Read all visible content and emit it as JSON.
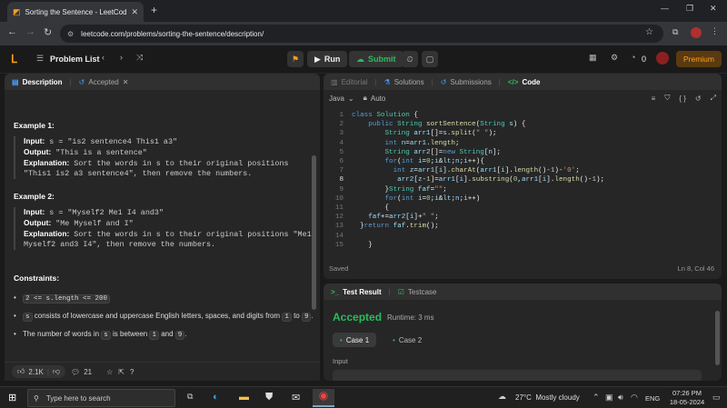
{
  "browser": {
    "tab_title": "Sorting the Sentence - LeetCod",
    "url": "leetcode.com/problems/sorting-the-sentence/description/"
  },
  "header": {
    "problem_list": "Problem List",
    "run": "Run",
    "submit": "Submit",
    "streak": "0",
    "premium": "Premium",
    "accent": "#ffa116"
  },
  "left_tabs": {
    "description": "Description",
    "accepted": "Accepted"
  },
  "examples": [
    {
      "title": "Example 1:",
      "input_label": "Input:",
      "input": " s = \"is2 sentence4 This1 a3\"",
      "output_label": "Output:",
      "output": " \"This is a sentence\"",
      "expl_label": "Explanation:",
      "expl": " Sort the words in s to their original positions \"This1 is2 a3 sentence4\", then remove the numbers."
    },
    {
      "title": "Example 2:",
      "input_label": "Input:",
      "input": " s = \"Myself2 Me1 I4 and3\"",
      "output_label": "Output:",
      "output": " \"Me Myself and I\"",
      "expl_label": "Explanation:",
      "expl": " Sort the words in s to their original positions \"Me1 Myself2 and3 I4\", then remove the numbers."
    }
  ],
  "constraints": {
    "title": "Constraints:",
    "c1": "2 <= s.length <= 200",
    "c2a": "s",
    "c2b": " consists of lowercase and uppercase English letters, spaces, and digits from ",
    "c2c": "1",
    "c2d": " to ",
    "c2e": "9",
    "c2f": ".",
    "c3a": "The number of words in ",
    "c3b": "s",
    "c3c": " is between ",
    "c3d": "1",
    "c3e": " and ",
    "c3f": "9",
    "c3g": "."
  },
  "desc_footer": {
    "likes": "2.1K",
    "comments": "21"
  },
  "right_tabs": {
    "editorial": "Editorial",
    "solutions": "Solutions",
    "submissions": "Submissions",
    "code": "Code"
  },
  "code_toolbar": {
    "language": "Java",
    "mode": "Auto"
  },
  "code_lines": [
    "class Solution {",
    "    public String sortSentence(String s) {",
    "        String arr1[]=s.split(\" \");",
    "        int n=arr1.length;",
    "        String arr2[]=new String[n];",
    "        for(int i=0;i<n;i++){",
    "          int z=arr1[i].charAt(arr1[i].length()-1)-'0';",
    "           arr2[z-1]=arr1[i].substring(0,arr1[i].length()-1);",
    "        }String faf=\"\";",
    "        for(int i=0;i<n;i++)",
    "        {",
    "    faf+=arr2[i]+\" \";",
    "  }return faf.trim();",
    "",
    "    }"
  ],
  "code_status": {
    "saved": "Saved",
    "position": "Ln 8, Col 46"
  },
  "test": {
    "result_tab": "Test Result",
    "testcase_tab": "Testcase",
    "status": "Accepted",
    "runtime": "Runtime: 3 ms",
    "case1": "Case 1",
    "case2": "Case 2",
    "input_label": "Input",
    "status_color": "#2cbb5d"
  },
  "taskbar": {
    "search": "Type here to search",
    "weather": "27°C  Mostly cloudy",
    "lang": "ENG",
    "time": "07:26 PM",
    "date": "18-05-2024"
  }
}
